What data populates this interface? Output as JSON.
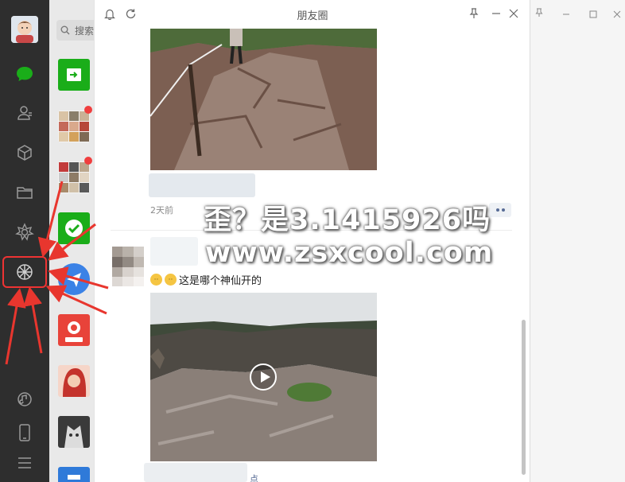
{
  "search": {
    "placeholder": "搜索"
  },
  "moments": {
    "title": "朋友圈",
    "post1": {
      "time": "2天前"
    },
    "post2": {
      "text": "这是哪个神仙开的"
    },
    "bottom_fragment": "点"
  },
  "overlay": {
    "watermark_line1": "歪？是3.1415926吗",
    "watermark_line2": "www.zsxcool.com"
  },
  "icons": {
    "nav": [
      "chat-icon",
      "contacts-icon",
      "cube-icon",
      "folder-icon",
      "mini-program-icon",
      "moments-icon",
      "music-icon",
      "phone-icon",
      "menu-icon"
    ],
    "titlebar": [
      "bell-icon",
      "refresh-icon",
      "pin-icon",
      "minimize-icon",
      "close-icon"
    ]
  },
  "colors": {
    "nav_bg": "#2e2e2e",
    "wechat_green": "#1aad19",
    "link": "#576b95",
    "highlight_red": "#e33333"
  }
}
